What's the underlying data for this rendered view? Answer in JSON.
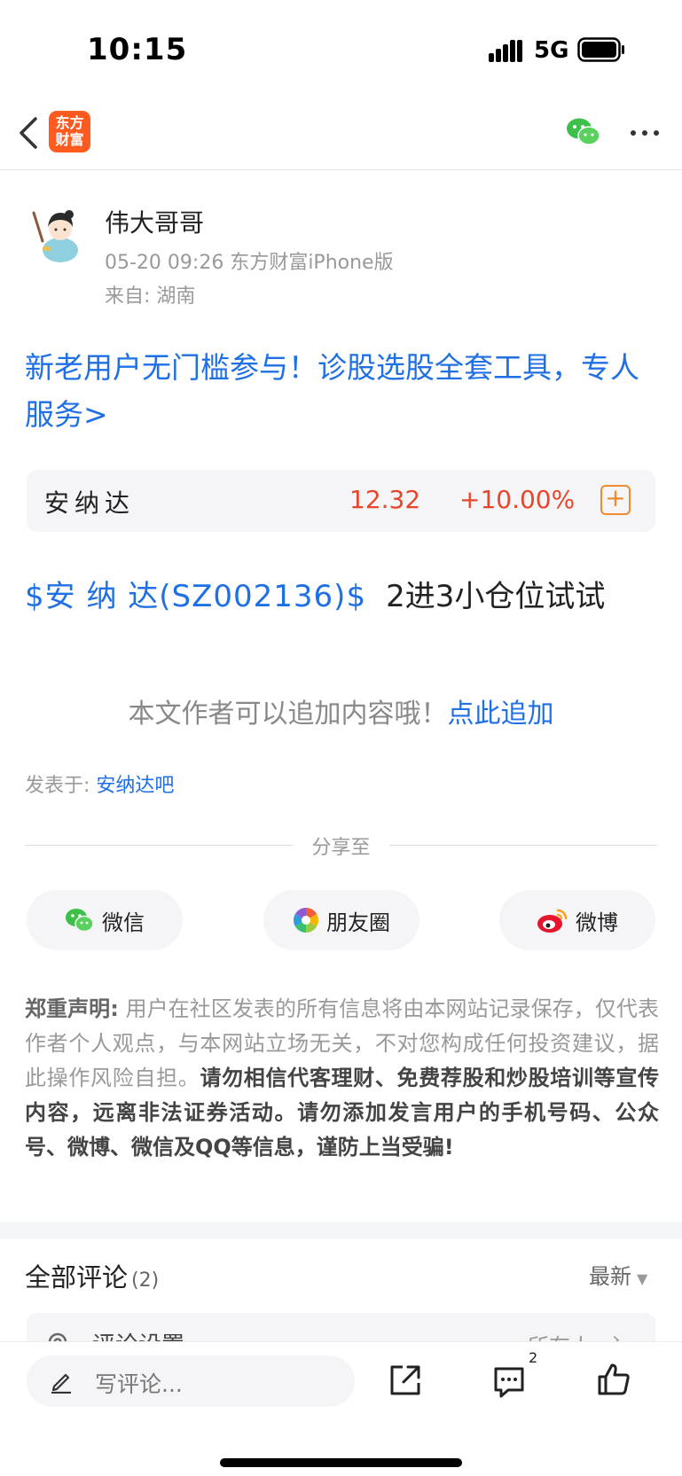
{
  "status_bar": {
    "time": "10:15",
    "network": "5G"
  },
  "nav": {
    "logo_text": "东方\n财富"
  },
  "author": {
    "name": "伟大哥哥",
    "meta": "05-20 09:26 东方财富iPhone版",
    "location": "来自: 湖南"
  },
  "promo": {
    "text": "新老用户无门槛参与！诊股选股全套工具，专人服务>"
  },
  "stock": {
    "name": "安纳达",
    "price": "12.32",
    "change": "+10.00%",
    "color_up": "#e8462c"
  },
  "post": {
    "stock_tag": "$安 纳 达(SZ002136)$",
    "text": "2进3小仓位试试"
  },
  "append": {
    "prompt": "本文作者可以追加内容哦！",
    "link": "点此追加"
  },
  "posted_in": {
    "label": "发表于:",
    "forum": "安纳达吧"
  },
  "share": {
    "title": "分享至",
    "wechat": "微信",
    "moments": "朋友圈",
    "weibo": "微博"
  },
  "disclaimer": {
    "head": "郑重声明:",
    "body": "用户在社区发表的所有信息将由本网站记录保存，仅代表作者个人观点，与本网站立场无关，不对您构成任何投资建议，据此操作风险自担。",
    "bold": "请勿相信代客理财、免费荐股和炒股培训等宣传内容，远离非法证券活动。请勿添加发言用户的手机号码、公众号、微博、微信及QQ等信息，谨防上当受骗!"
  },
  "comments": {
    "title": "全部评论",
    "count": "(2)",
    "sort": "最新",
    "settings_label": "评论设置",
    "settings_value": "所有人"
  },
  "bottom_bar": {
    "placeholder": "写评论...",
    "comment_badge": "2"
  },
  "colors": {
    "link_blue": "#1f6fe5",
    "brand_orange": "#ff5a1f"
  }
}
